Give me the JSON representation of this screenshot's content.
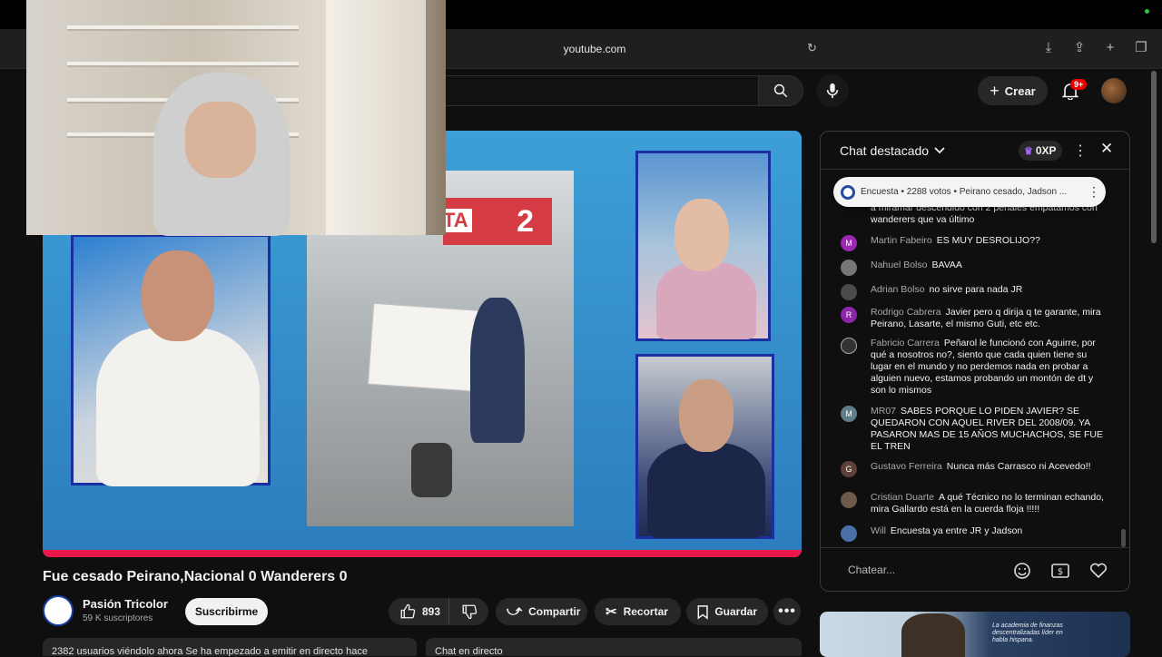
{
  "browser": {
    "url": "youtube.com"
  },
  "youtube": {
    "create_label": "Crear",
    "notification_badge": "9+"
  },
  "video": {
    "title": "Fue cesado Peirano,Nacional 0 Wanderers 0",
    "sign_number": "2",
    "sign_letters": "TA"
  },
  "channel": {
    "name": "Pasión Tricolor",
    "subscribers": "59 K suscriptores",
    "subscribe_label": "Suscribirme"
  },
  "actions": {
    "likes": "893",
    "share": "Compartir",
    "clip": "Recortar",
    "save": "Guardar"
  },
  "below": {
    "description_preview": "2382 usuarios viéndolo ahora  Se ha empezado a emitir en directo hace",
    "chat_replay": "Chat en directo"
  },
  "chat": {
    "title": "Chat destacado",
    "xp": "0XP",
    "poll": "Encuesta • 2288 votos • Peirano cesado, Jadson ...",
    "input_placeholder": "Chatear...",
    "messages": [
      {
        "author": "",
        "text": "a miramar descendido con 2 penales empatamos con wanderers que va último",
        "avatar": "",
        "color": "#555"
      },
      {
        "author": "Martin Fabeiro",
        "text": "ES MUY DESROLIJO??",
        "avatar": "M",
        "color": "#9c27b0"
      },
      {
        "author": "Nahuel Bolso",
        "text": "BAVAA",
        "avatar": "",
        "color": "#777"
      },
      {
        "author": "Adrian Bolso",
        "text": "no sirve para nada JR",
        "avatar": "",
        "color": "#4a4a4a"
      },
      {
        "author": "Rodrigo Cabrera",
        "text": "Javier pero q dirija q te garante, mira Peirano, Lasarte, el mismo Guti, etc etc.",
        "avatar": "R",
        "color": "#8e24aa"
      },
      {
        "author": "Fabricio Carrera",
        "text": "Peñarol le funcionó con Aguirre, por qué a nosotros no?, siento que cada quien tiene su lugar en el mundo y no perdemos nada en probar a alguien nuevo, estamos probando un montón de dt y son lo mismos",
        "avatar": "",
        "color": "#333"
      },
      {
        "author": "MR07",
        "text": "SABES PORQUE LO PIDEN JAVIER? SE QUEDARON CON AQUEL RIVER DEL 2008/09. YA PASARON MAS DE 15 AÑOS MUCHACHOS, SE FUE EL TREN",
        "avatar": "M",
        "color": "#607d8b"
      },
      {
        "author": "Gustavo Ferreira",
        "text": "Nunca más Carrasco ni Acevedo!!",
        "avatar": "G",
        "color": "#5d4037"
      },
      {
        "author": "Cristian Duarte",
        "text": "A qué Técnico no lo terminan echando, mira Gallardo está en la cuerda floja !!!!!",
        "avatar": "",
        "color": "#6d5a48"
      },
      {
        "author": "Will",
        "text": "Encuesta ya entre JR y Jadson",
        "avatar": "",
        "color": "#4a6fa5"
      }
    ]
  },
  "ad": {
    "text": "La academia de finanzas descentralizadas líder en habla hispana."
  }
}
